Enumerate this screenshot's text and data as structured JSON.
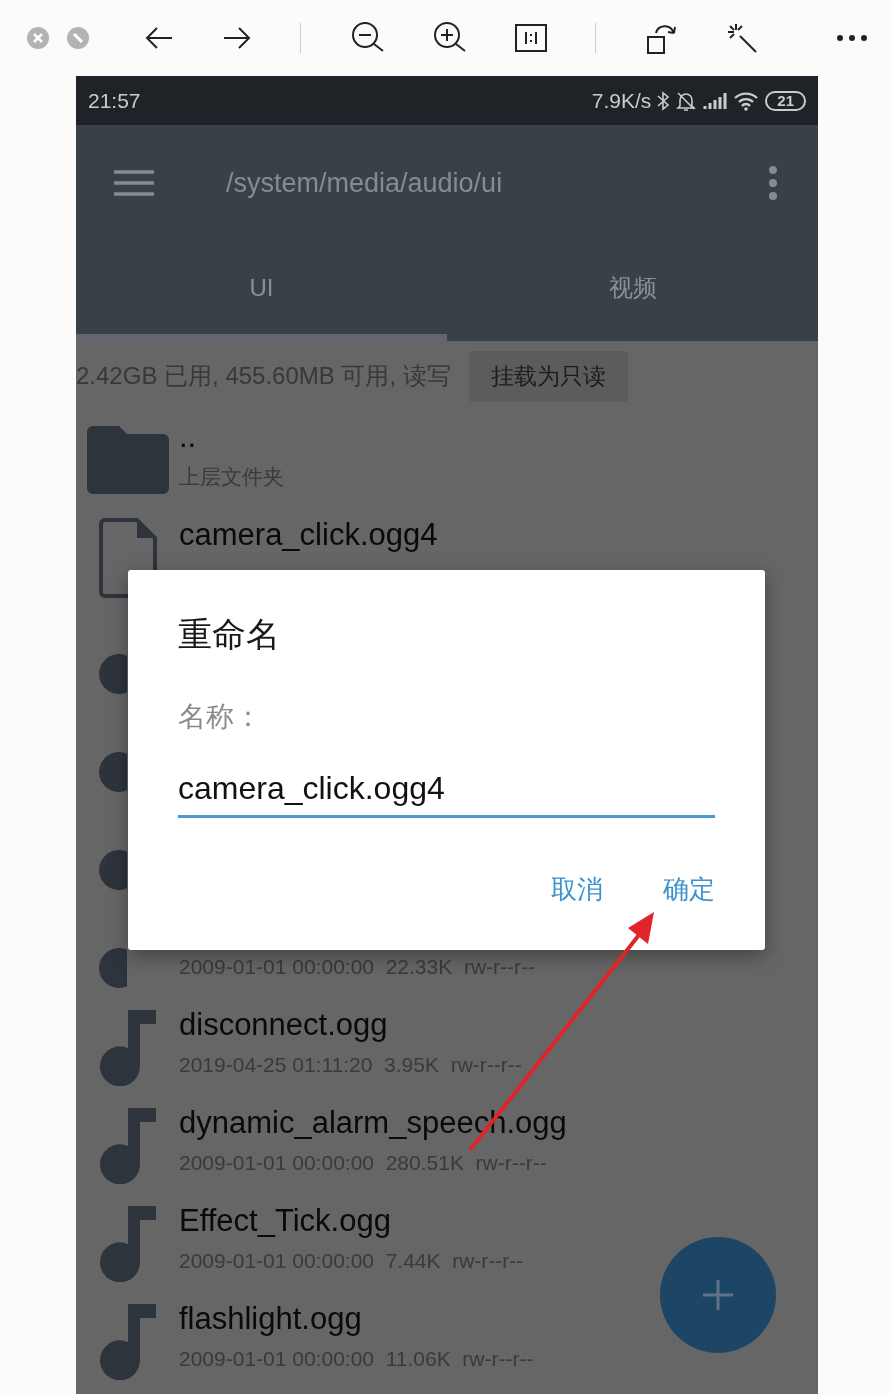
{
  "status_bar": {
    "time": "21:57",
    "net_speed": "7.9K/s",
    "battery": "21"
  },
  "app_bar": {
    "path": "/system/media/audio/ui"
  },
  "tabs": [
    {
      "label": "UI",
      "selected": true
    },
    {
      "label": "视频",
      "selected": false
    }
  ],
  "storage": {
    "text": "2.42GB 已用, 455.60MB 可用, 读写",
    "button": "挂载为只读"
  },
  "files": [
    {
      "kind": "folder",
      "name": "..",
      "meta": "上层文件夹"
    },
    {
      "kind": "file",
      "name": "camera_click.ogg4"
    },
    {
      "kind": "audio"
    },
    {
      "kind": "audio"
    },
    {
      "kind": "audio"
    },
    {
      "kind": "audio",
      "meta": "2009-01-01 00:00:00  22.33K  rw-r--r--"
    },
    {
      "kind": "audio",
      "name": "disconnect.ogg",
      "meta": "2019-04-25 01:11:20  3.95K  rw-r--r--"
    },
    {
      "kind": "audio",
      "name": "dynamic_alarm_speech.ogg",
      "meta": "2009-01-01 00:00:00  280.51K  rw-r--r--"
    },
    {
      "kind": "audio",
      "name": "Effect_Tick.ogg",
      "meta": "2009-01-01 00:00:00  7.44K  rw-r--r--"
    },
    {
      "kind": "audio",
      "name": "flashlight.ogg",
      "meta": "2009-01-01 00:00:00  11.06K  rw-r--r--"
    }
  ],
  "dialog": {
    "title": "重命名",
    "label": "名称：",
    "value": "camera_click.ogg4",
    "buttons": [
      "取消",
      "确定"
    ]
  }
}
